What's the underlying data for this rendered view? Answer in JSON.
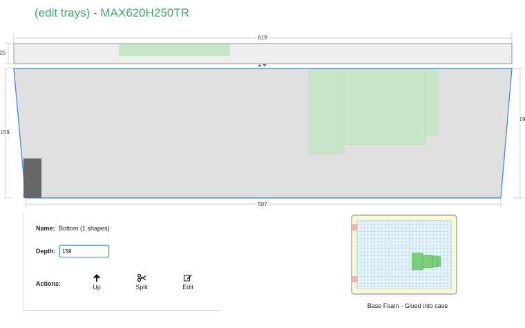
{
  "page": {
    "title": "(edit trays) - MAX620H250TR"
  },
  "dimensions": {
    "top_width": "619",
    "left_top_height": "25",
    "left_height": "159",
    "right_height": "19",
    "bottom_width": "587"
  },
  "details": {
    "name_label": "Name:",
    "name_value": "Bottom (1 shapes)",
    "depth_label": "Depth:",
    "depth_value": "159",
    "actions_label": "Actions:",
    "actions": [
      {
        "label": "Up",
        "icon": "arrow-up-icon"
      },
      {
        "label": "Split",
        "icon": "scissors-icon"
      },
      {
        "label": "Edit",
        "icon": "edit-icon"
      }
    ]
  },
  "preview": {
    "caption": "Base Foam - Glued into case"
  },
  "colors": {
    "title": "#3aaa6a",
    "tray_fill": "#e0e0e0",
    "shape_fill": "#c8e6c9",
    "selection_outline": "#4a90e2",
    "block": "#666666"
  }
}
